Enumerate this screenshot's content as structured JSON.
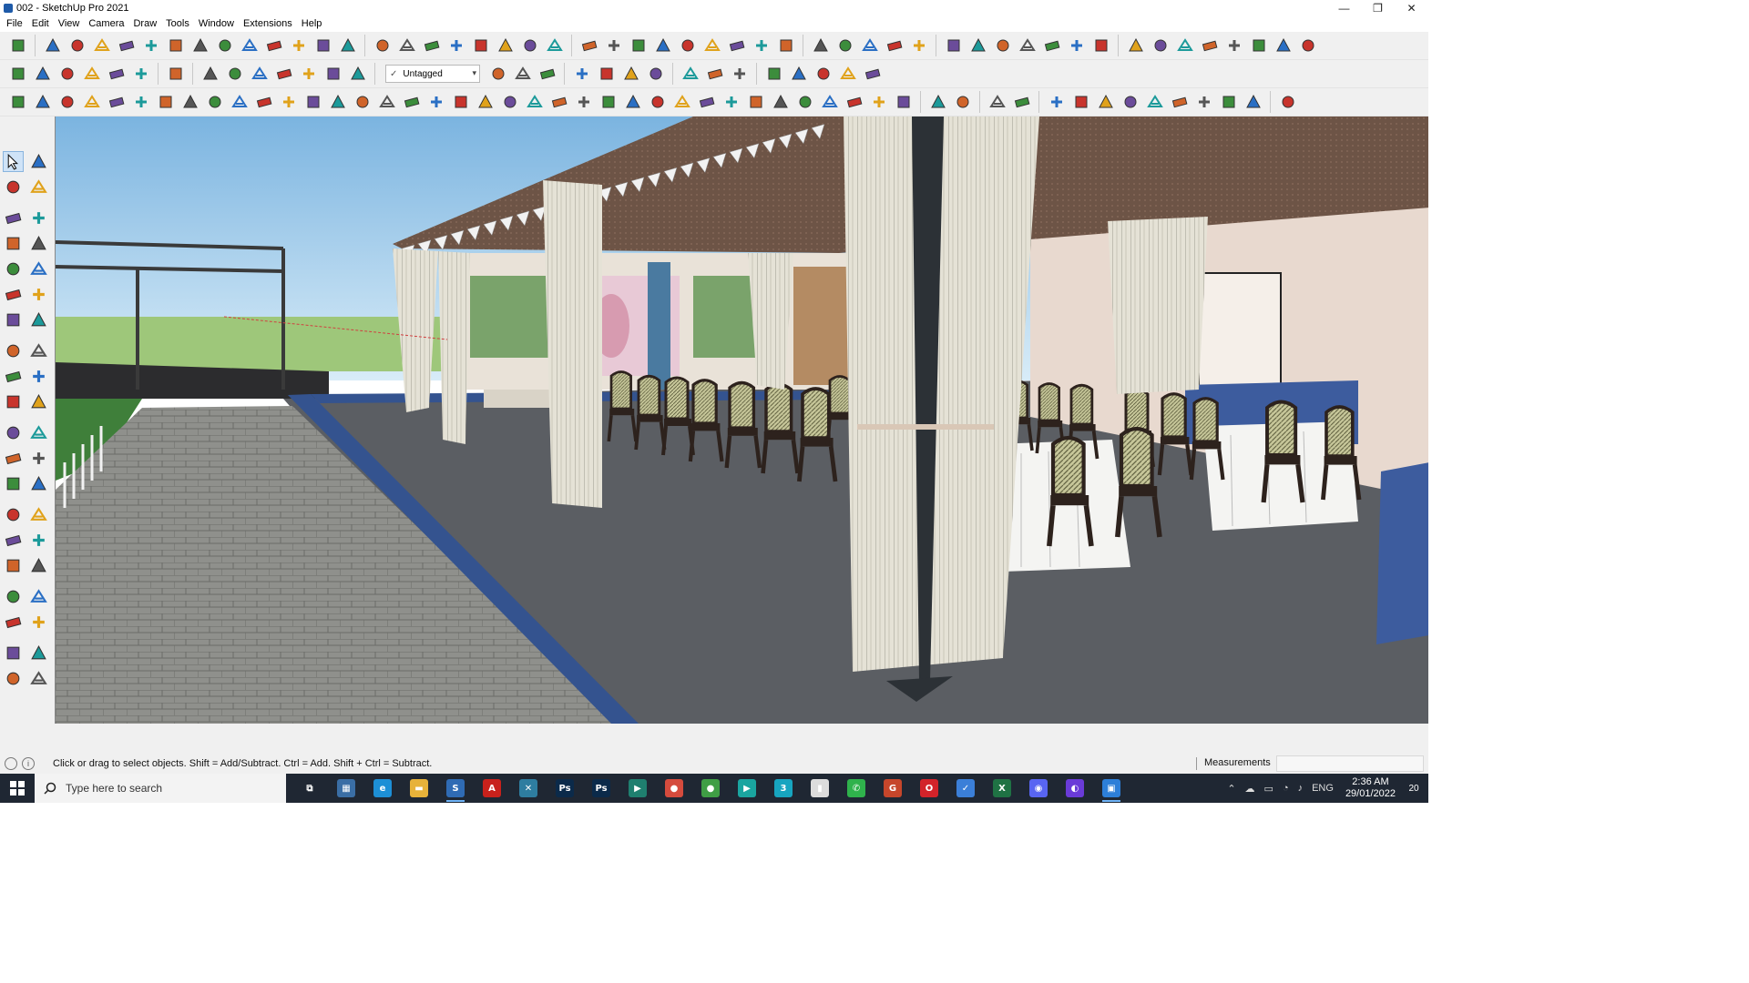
{
  "window": {
    "title": "002 - SketchUp Pro 2021",
    "controls": {
      "minimize": "—",
      "maximize": "❐",
      "close": "✕"
    }
  },
  "menu": [
    "File",
    "Edit",
    "View",
    "Camera",
    "Draw",
    "Tools",
    "Window",
    "Extensions",
    "Help"
  ],
  "layer_dropdown": {
    "check": "✓",
    "value": "Untagged"
  },
  "status": {
    "hint": "Click or drag to select objects. Shift = Add/Subtract. Ctrl = Add. Shift + Ctrl = Subtract.",
    "measurements_label": "Measurements",
    "info_icon": "i"
  },
  "taskbar": {
    "search_placeholder": "Type here to search",
    "apps": [
      {
        "name": "task-view",
        "label": "⧉",
        "color": "#1f2733"
      },
      {
        "name": "calculator",
        "label": "▦",
        "color": "#3a6ea5"
      },
      {
        "name": "edge",
        "label": "e",
        "color": "#1d8fd6"
      },
      {
        "name": "file-explorer",
        "label": "▬",
        "color": "#e7b23a"
      },
      {
        "name": "sketchup",
        "label": "S",
        "color": "#2f6bb4"
      },
      {
        "name": "acrobat",
        "label": "A",
        "color": "#c8211c"
      },
      {
        "name": "app-7",
        "label": "✕",
        "color": "#2e7da0"
      },
      {
        "name": "photoshop-1",
        "label": "Ps",
        "color": "#0b2a4a"
      },
      {
        "name": "photoshop-2",
        "label": "Ps",
        "color": "#0b2a4a"
      },
      {
        "name": "app-10",
        "label": "▶",
        "color": "#1f7f6f"
      },
      {
        "name": "chrome-1",
        "label": "●",
        "color": "#d54b3d"
      },
      {
        "name": "chrome-2",
        "label": "●",
        "color": "#3f9e45"
      },
      {
        "name": "app-13",
        "label": "▶",
        "color": "#1aa5a0"
      },
      {
        "name": "app-14",
        "label": "3",
        "color": "#17a5c0"
      },
      {
        "name": "notes",
        "label": "▮",
        "color": "#dcdcdc"
      },
      {
        "name": "whatsapp",
        "label": "✆",
        "color": "#2fb24c"
      },
      {
        "name": "grammarly",
        "label": "G",
        "color": "#c6462b"
      },
      {
        "name": "opera",
        "label": "O",
        "color": "#d2232a"
      },
      {
        "name": "app-19",
        "label": "✓",
        "color": "#3b7fd8"
      },
      {
        "name": "excel",
        "label": "X",
        "color": "#1f7244"
      },
      {
        "name": "discord",
        "label": "◉",
        "color": "#5865f2"
      },
      {
        "name": "app-22",
        "label": "◐",
        "color": "#6a3bd8"
      },
      {
        "name": "app-23",
        "label": "▣",
        "color": "#2d7fd8"
      }
    ],
    "tray": {
      "lang": "ENG",
      "time": "2:36 AM",
      "date": "29/01/2022",
      "notifications": "20"
    }
  },
  "colors": {
    "sky_top": "#7bb4e0",
    "sky_horizon": "#d8ecf8",
    "ground_far": "#9ec77a",
    "floor": "#5b5e63",
    "pavement": "#8b8c88",
    "wall": "#e8d9cf",
    "curtain": "#e5e2d6",
    "roof": "#6d5446",
    "chair": "#2d221d",
    "table": "#f4f4f2",
    "blue_border": "#34538f"
  }
}
